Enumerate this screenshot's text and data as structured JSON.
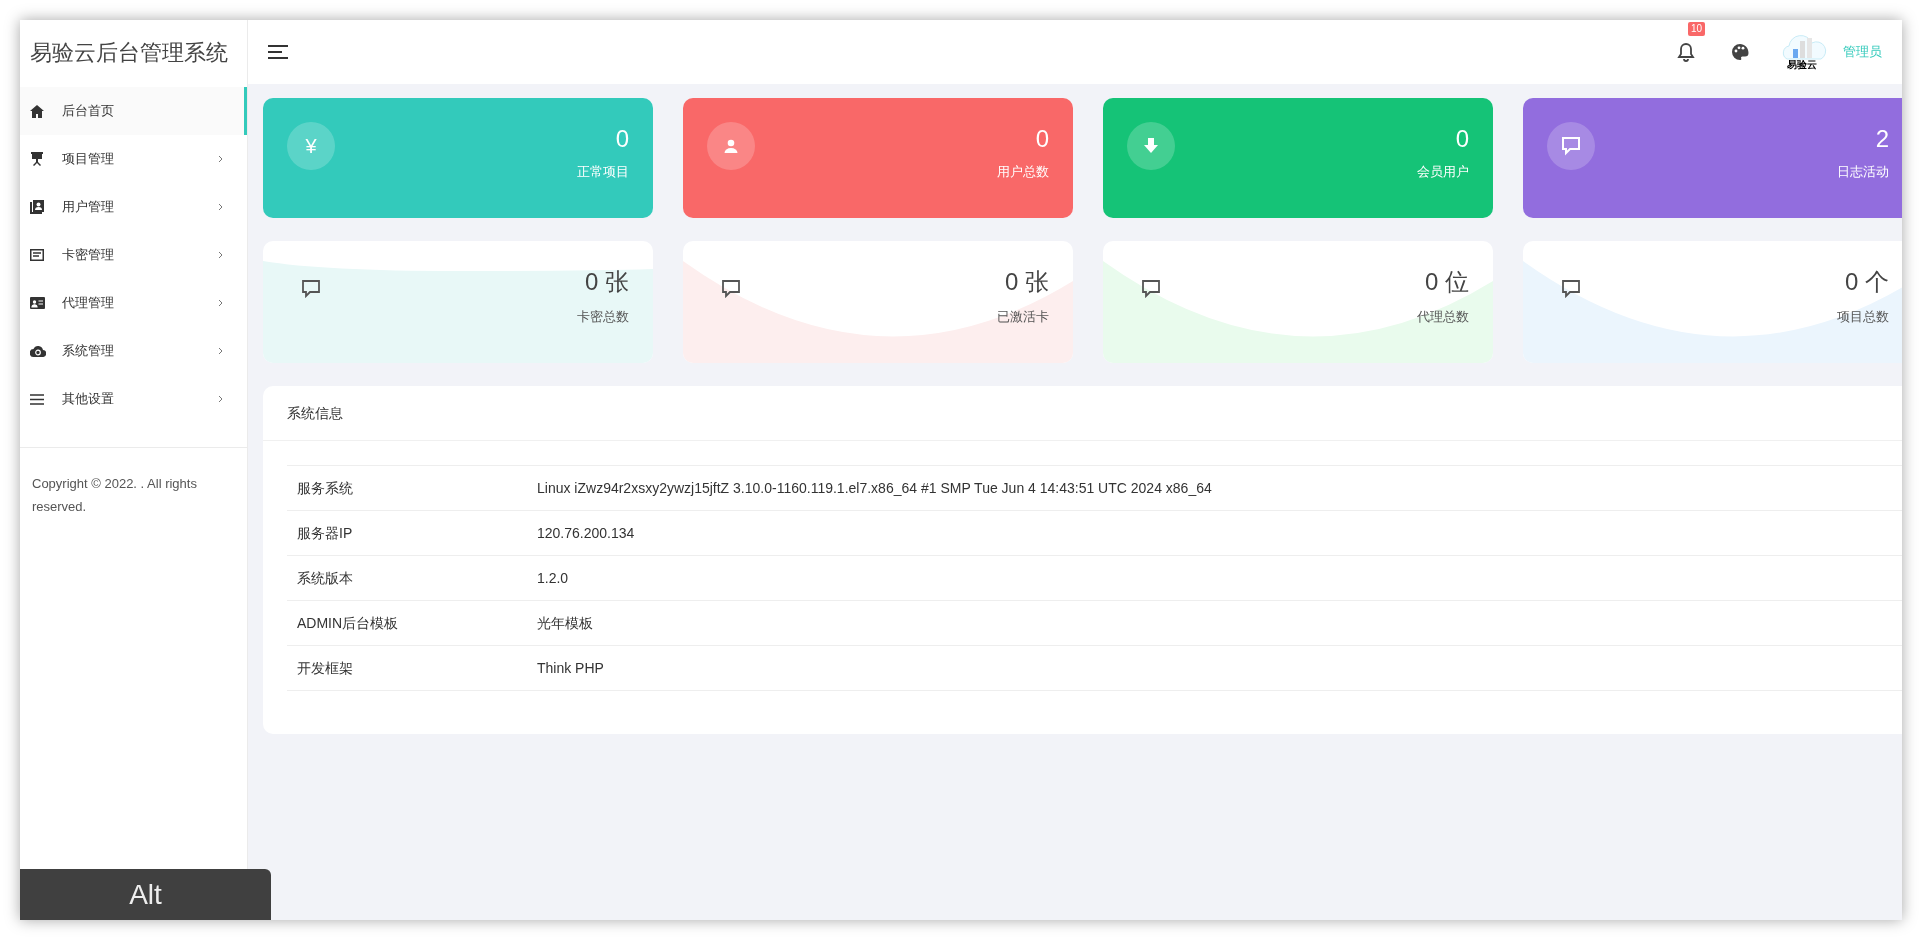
{
  "sidebar": {
    "title": "易验云后台管理系统",
    "items": [
      {
        "label": "后台首页",
        "selected": true,
        "has_children": false
      },
      {
        "label": "项目管理",
        "selected": false,
        "has_children": true
      },
      {
        "label": "用户管理",
        "selected": false,
        "has_children": true
      },
      {
        "label": "卡密管理",
        "selected": false,
        "has_children": true
      },
      {
        "label": "代理管理",
        "selected": false,
        "has_children": true
      },
      {
        "label": "系统管理",
        "selected": false,
        "has_children": true
      },
      {
        "label": "其他设置",
        "selected": false,
        "has_children": true
      }
    ],
    "footer": "Copyright © 2022. . All rights reserved."
  },
  "header": {
    "notification_count": "10",
    "avatar_text": "易验云",
    "user": "管理员"
  },
  "stat_cards": [
    {
      "icon_text": "¥",
      "value": "0",
      "label": "正常项目",
      "color": "#33cabb"
    },
    {
      "value": "0",
      "label": "用户总数",
      "color": "#f96868"
    },
    {
      "value": "0",
      "label": "会员用户",
      "color": "#15c377"
    },
    {
      "value": "2",
      "label": "日志活动",
      "color": "#926dde"
    }
  ],
  "count_cards": [
    {
      "value": "0 张",
      "label": "卡密总数",
      "color": "#e8f8f7"
    },
    {
      "value": "0 张",
      "label": "已激活卡",
      "color": "#fdeeee"
    },
    {
      "value": "0 位",
      "label": "代理总数",
      "color": "#e9fbed"
    },
    {
      "value": "0 个",
      "label": "项目总数",
      "color": "#ebf5fd"
    }
  ],
  "system_info": {
    "title": "系统信息",
    "rows": [
      {
        "key": "服务系统",
        "value": "Linux iZwz94r2xsxy2ywzj15jftZ 3.10.0-1160.119.1.el7.x86_64 #1 SMP Tue Jun 4 14:43:51 UTC 2024 x86_64"
      },
      {
        "key": "服务器IP",
        "value": "120.76.200.134"
      },
      {
        "key": "系统版本",
        "value": "1.2.0"
      },
      {
        "key": "ADMIN后台模板",
        "value": "光年模板"
      },
      {
        "key": "开发框架",
        "value": "Think PHP"
      }
    ]
  },
  "key_overlay": "Alt"
}
